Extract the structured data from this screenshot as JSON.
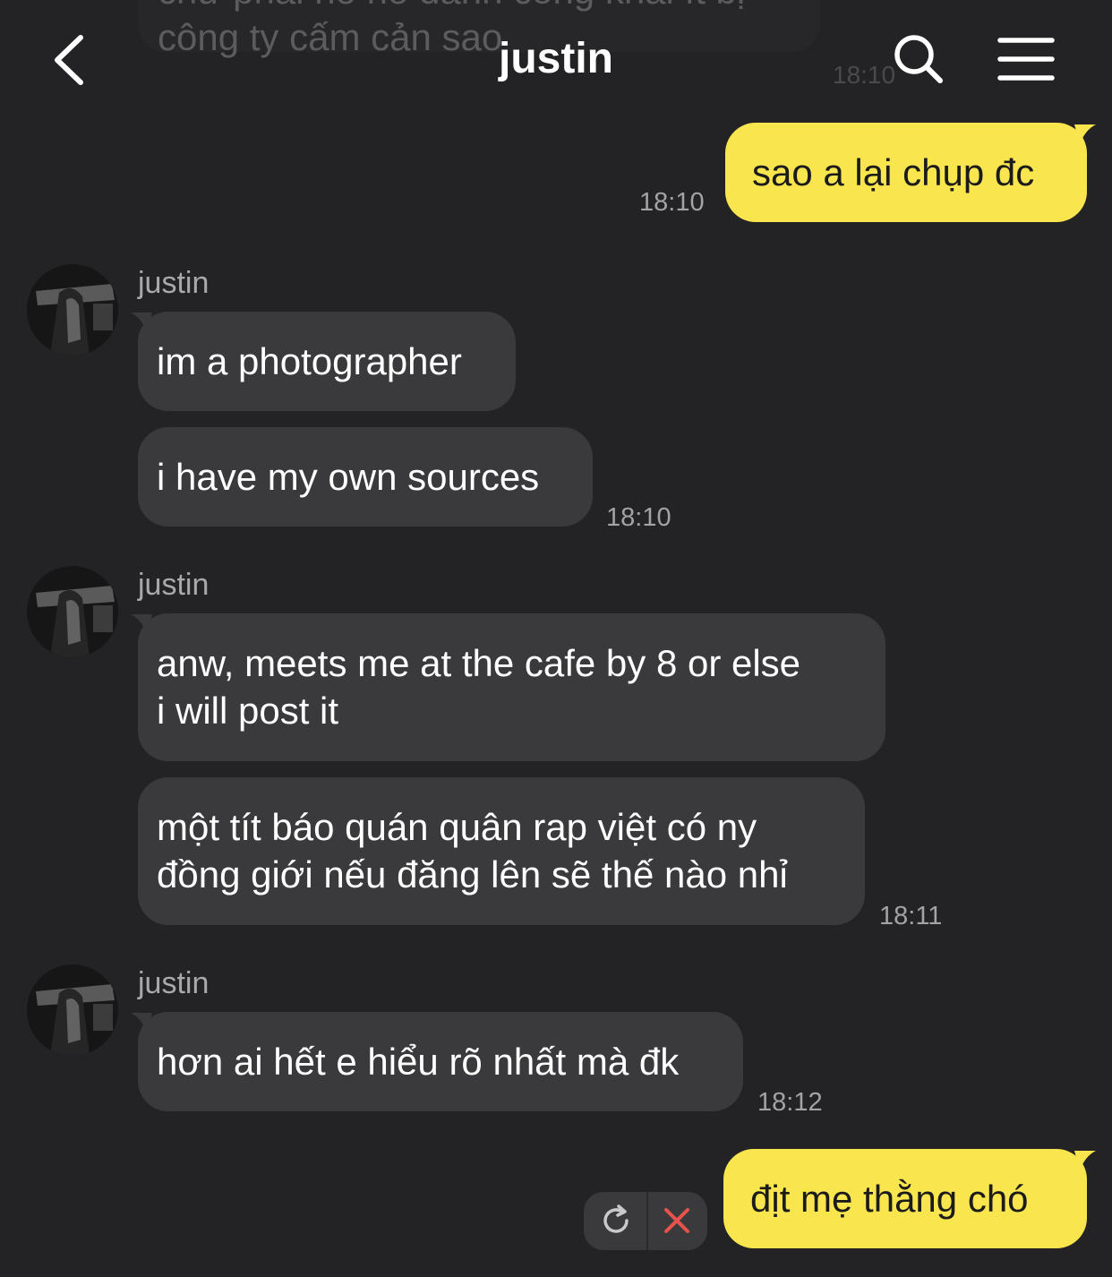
{
  "header": {
    "title": "justin",
    "back_icon": "chevron-left-icon",
    "search_icon": "search-icon",
    "menu_icon": "hamburger-menu-icon"
  },
  "ghost": {
    "line1": "chứ phải nó nó đánh công khai ít bị",
    "line2": "công ty cấm cản sao",
    "time": "18:10"
  },
  "colors": {
    "background": "#232325",
    "incoming_bubble": "#3a3a3c",
    "outgoing_bubble": "#f9e54d",
    "timestamp": "#a3a3a5",
    "delete_x": "#e5534b"
  },
  "messages": [
    {
      "direction": "out",
      "text": "sao a lại chụp đc",
      "time": "18:10"
    },
    {
      "direction": "in",
      "sender": "justin",
      "lines": [
        "im a photographer"
      ]
    },
    {
      "direction": "in",
      "lines": [
        "i have my own sources"
      ],
      "time": "18:10"
    },
    {
      "direction": "in",
      "sender": "justin",
      "lines": [
        "anw, meets me at the cafe by 8 or else",
        "i will post it"
      ]
    },
    {
      "direction": "in",
      "lines": [
        "một tít báo quán quân rap việt có ny",
        "đồng giới nếu đăng lên sẽ thế nào nhỉ"
      ],
      "time": "18:11"
    },
    {
      "direction": "in",
      "sender": "justin",
      "lines": [
        "hơn ai hết e hiểu rõ nhất mà đk"
      ],
      "time": "18:12"
    },
    {
      "direction": "out",
      "text": "địt mẹ thằng chó",
      "status": "failed"
    }
  ],
  "failed_actions": {
    "retry_icon": "retry-icon",
    "delete_icon": "close-icon"
  }
}
